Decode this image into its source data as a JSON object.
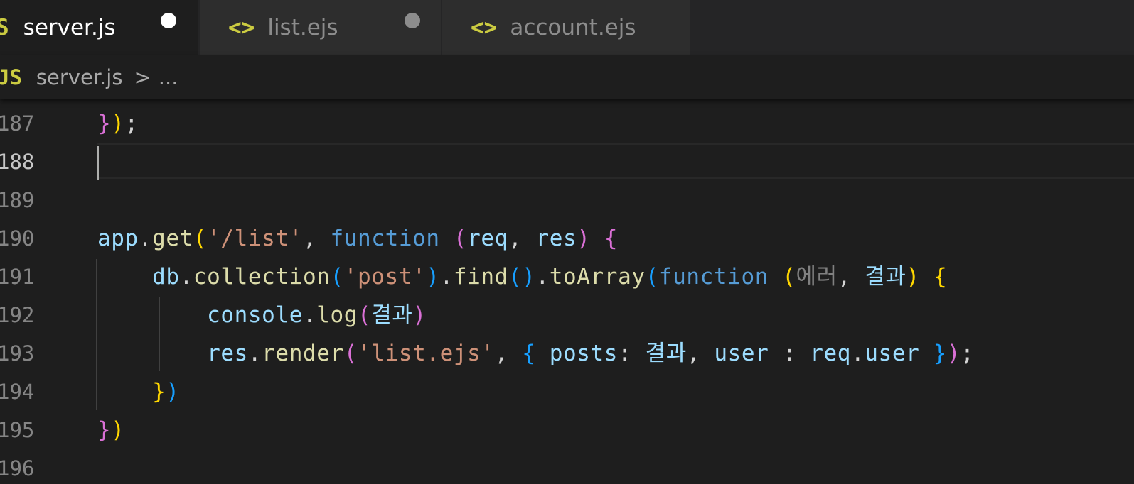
{
  "tabs": [
    {
      "icon": "S",
      "label": "server.js",
      "dirty": true,
      "active": true
    },
    {
      "icon": "<>",
      "label": "list.ejs",
      "dirty": true,
      "active": false
    },
    {
      "icon": "<>",
      "label": "account.ejs",
      "dirty": false,
      "active": false
    }
  ],
  "breadcrumb": {
    "icon": "JS",
    "file": "server.js",
    "separator": ">",
    "more": "..."
  },
  "editor": {
    "current_line": "188",
    "lines": [
      {
        "number": "187",
        "tokens": [
          [
            "}",
            "b2"
          ],
          [
            ")",
            "b1"
          ],
          [
            ";",
            "t-plain"
          ]
        ]
      },
      {
        "number": "188",
        "tokens": []
      },
      {
        "number": "189",
        "tokens": []
      },
      {
        "number": "190",
        "tokens": [
          [
            "app",
            "t-var"
          ],
          [
            ".",
            "t-plain"
          ],
          [
            "get",
            "t-fn"
          ],
          [
            "(",
            "b1"
          ],
          [
            "'/list'",
            "t-str"
          ],
          [
            ", ",
            "t-plain"
          ],
          [
            "function",
            "t-kw"
          ],
          [
            " ",
            "t-plain"
          ],
          [
            "(",
            "b2"
          ],
          [
            "req",
            "t-var"
          ],
          [
            ", ",
            "t-plain"
          ],
          [
            "res",
            "t-var"
          ],
          [
            ")",
            "b2"
          ],
          [
            " ",
            "t-plain"
          ],
          [
            "{",
            "b2"
          ]
        ]
      },
      {
        "number": "191",
        "tokens": [
          [
            "    ",
            "t-plain"
          ],
          [
            "db",
            "t-var"
          ],
          [
            ".",
            "t-plain"
          ],
          [
            "collection",
            "t-fn"
          ],
          [
            "(",
            "b3"
          ],
          [
            "'post'",
            "t-str"
          ],
          [
            ")",
            "b3"
          ],
          [
            ".",
            "t-plain"
          ],
          [
            "find",
            "t-fn"
          ],
          [
            "(",
            "b3"
          ],
          [
            ")",
            "b3"
          ],
          [
            ".",
            "t-plain"
          ],
          [
            "toArray",
            "t-fn"
          ],
          [
            "(",
            "b3"
          ],
          [
            "function",
            "t-kw"
          ],
          [
            " ",
            "t-plain"
          ],
          [
            "(",
            "b1"
          ],
          [
            "에러",
            "t-dim"
          ],
          [
            ", ",
            "t-plain"
          ],
          [
            "결과",
            "t-var"
          ],
          [
            ")",
            "b1"
          ],
          [
            " ",
            "t-plain"
          ],
          [
            "{",
            "b1"
          ]
        ]
      },
      {
        "number": "192",
        "tokens": [
          [
            "        ",
            "t-plain"
          ],
          [
            "console",
            "t-var"
          ],
          [
            ".",
            "t-plain"
          ],
          [
            "log",
            "t-fn"
          ],
          [
            "(",
            "b2"
          ],
          [
            "결과",
            "t-var"
          ],
          [
            ")",
            "b2"
          ]
        ]
      },
      {
        "number": "193",
        "tokens": [
          [
            "        ",
            "t-plain"
          ],
          [
            "res",
            "t-var"
          ],
          [
            ".",
            "t-plain"
          ],
          [
            "render",
            "t-fn"
          ],
          [
            "(",
            "b2"
          ],
          [
            "'list.ejs'",
            "t-str"
          ],
          [
            ", ",
            "t-plain"
          ],
          [
            "{",
            "b3"
          ],
          [
            " ",
            "t-plain"
          ],
          [
            "posts",
            "t-var"
          ],
          [
            ": ",
            "t-plain"
          ],
          [
            "결과",
            "t-var"
          ],
          [
            ", ",
            "t-plain"
          ],
          [
            "user",
            "t-var"
          ],
          [
            " : ",
            "t-plain"
          ],
          [
            "req",
            "t-var"
          ],
          [
            ".",
            "t-plain"
          ],
          [
            "user",
            "t-var"
          ],
          [
            " ",
            "t-plain"
          ],
          [
            "}",
            "b3"
          ],
          [
            ")",
            "b2"
          ],
          [
            ";",
            "t-plain"
          ]
        ]
      },
      {
        "number": "194",
        "tokens": [
          [
            "    ",
            "t-plain"
          ],
          [
            "}",
            "b1"
          ],
          [
            ")",
            "b3"
          ]
        ]
      },
      {
        "number": "195",
        "tokens": [
          [
            "}",
            "b2"
          ],
          [
            ")",
            "b1"
          ]
        ]
      },
      {
        "number": "196",
        "tokens": []
      }
    ]
  },
  "colors": {
    "background": "#1e1e1e",
    "tab_inactive": "#2d2d2d",
    "js_icon": "#cbcb41",
    "dirty_dot_active": "#ffffff",
    "dirty_dot_inactive": "#8c8c8c"
  }
}
